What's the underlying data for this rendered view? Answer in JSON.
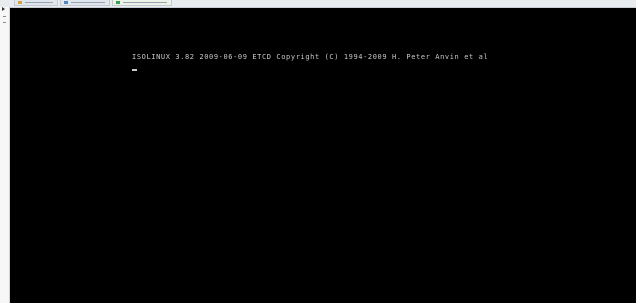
{
  "console": {
    "boot_message": "ISOLINUX 3.82 2009-06-09 ETCD Copyright (C) 1994-2009 H. Peter Anvin et al",
    "background_color": "#000000",
    "text_color": "#c8c8c8"
  },
  "host_window": {
    "tabs": [
      {
        "icon": "folder-icon"
      },
      {
        "icon": "document-icon"
      },
      {
        "icon": "vm-icon"
      }
    ]
  }
}
